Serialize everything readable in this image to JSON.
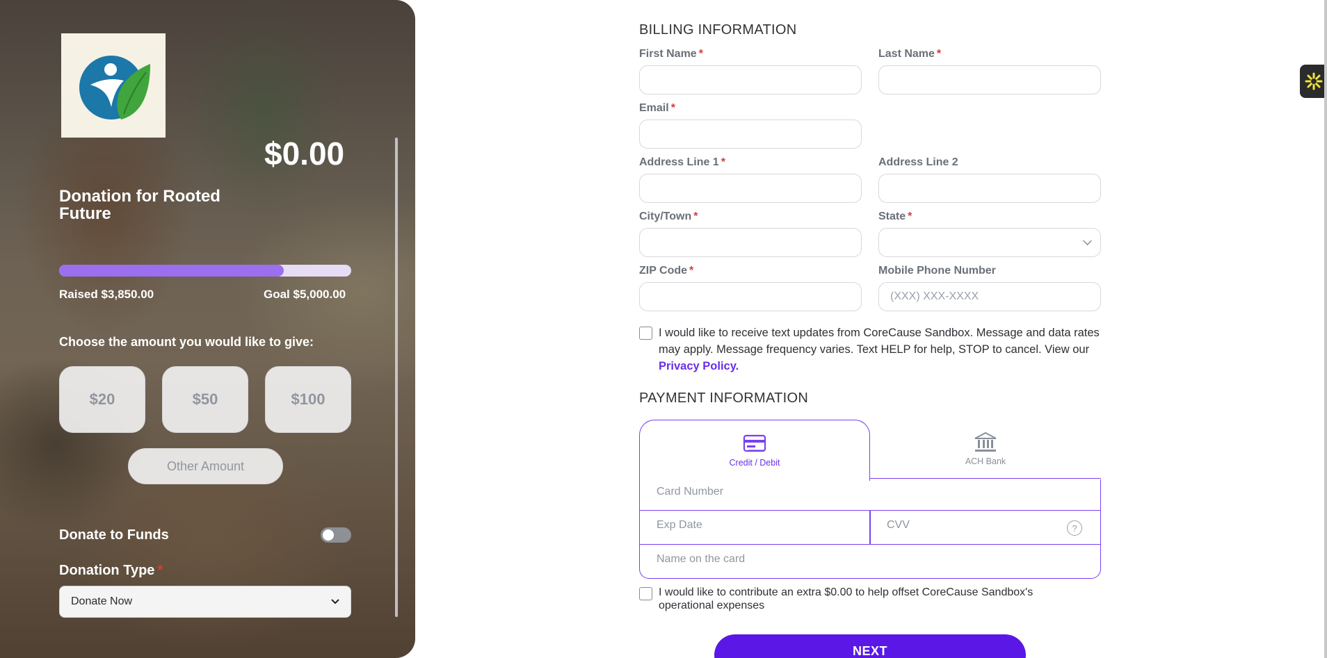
{
  "hero": {
    "amount_total": "$0.00",
    "campaign_title": "Donation for Rooted Future",
    "progress_fraction": 0.77,
    "raised": "Raised $3,850.00",
    "goal": "Goal $5,000.00",
    "choose_label": "Choose the amount you would like to give:",
    "amounts": [
      "$20",
      "$50",
      "$100"
    ],
    "other_amount": "Other Amount",
    "donate_to_funds": "Donate to Funds",
    "donate_to_funds_on": false,
    "donation_type_label": "Donation Type",
    "donation_type_value": "Donate Now",
    "required_mark": "*"
  },
  "billing": {
    "title": "BILLING INFORMATION",
    "first_name": "First Name",
    "last_name": "Last Name",
    "email": "Email",
    "address1": "Address Line 1",
    "address2": "Address Line 2",
    "city": "City/Town",
    "state": "State",
    "zip": "ZIP Code",
    "mobile": "Mobile Phone Number",
    "mobile_placeholder": "(XXX) XXX-XXXX",
    "required_mark": "*",
    "sms_consent": "I would like to receive text updates from CoreCause Sandbox. Message and data rates may apply. Message frequency varies. Text HELP for help, STOP to cancel. View our",
    "privacy_link": "Privacy Policy."
  },
  "payment": {
    "title": "PAYMENT INFORMATION",
    "tab_card": "Credit / Debit",
    "tab_ach": "ACH Bank",
    "card_number": "Card Number",
    "exp_date": "Exp Date",
    "cvv": "CVV",
    "cvv_help": "?",
    "name_on_card": "Name on the card",
    "extra_contribution": "I would like to contribute an extra $0.00 to help offset CoreCause Sandbox's operational expenses",
    "next": "NEXT"
  },
  "colors": {
    "accent": "#5a17e6",
    "tab_border": "#7a3ff0",
    "progress_fill": "#9b6ff0",
    "required": "#d83a3a"
  }
}
